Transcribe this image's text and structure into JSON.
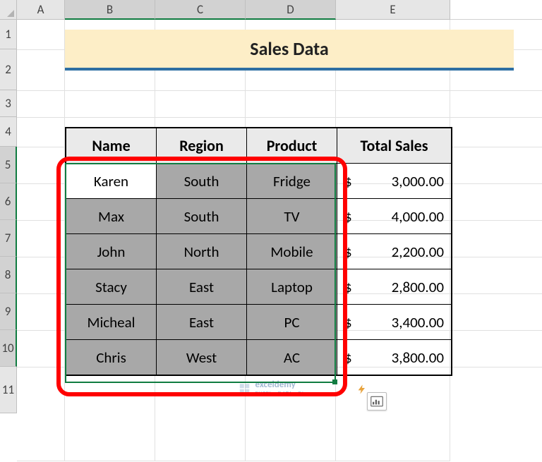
{
  "columns": [
    {
      "id": "A",
      "label": "A",
      "w": 68,
      "sel": false
    },
    {
      "id": "B",
      "label": "B",
      "w": 128,
      "sel": true
    },
    {
      "id": "C",
      "label": "C",
      "w": 128,
      "sel": true
    },
    {
      "id": "D",
      "label": "D",
      "w": 128,
      "sel": true
    },
    {
      "id": "E",
      "label": "E",
      "w": 162,
      "sel": false
    }
  ],
  "rows": [
    {
      "n": 1,
      "h": 42,
      "sel": false
    },
    {
      "n": 2,
      "h": 58,
      "sel": false
    },
    {
      "n": 3,
      "h": 38,
      "sel": false
    },
    {
      "n": 4,
      "h": 42,
      "sel": false
    },
    {
      "n": 5,
      "h": 52,
      "sel": true
    },
    {
      "n": 6,
      "h": 52,
      "sel": true
    },
    {
      "n": 7,
      "h": 52,
      "sel": true
    },
    {
      "n": 8,
      "h": 52,
      "sel": true
    },
    {
      "n": 9,
      "h": 52,
      "sel": true
    },
    {
      "n": 10,
      "h": 52,
      "sel": true
    },
    {
      "n": 11,
      "h": 66,
      "sel": false
    }
  ],
  "title": "Sales Data",
  "table": {
    "headers": [
      "Name",
      "Region",
      "Product",
      "Total Sales"
    ],
    "rows": [
      {
        "name": "Karen",
        "region": "South",
        "product": "Fridge",
        "total": "3,000.00"
      },
      {
        "name": "Max",
        "region": "South",
        "product": "TV",
        "total": "4,000.00"
      },
      {
        "name": "John",
        "region": "North",
        "product": "Mobile",
        "total": "2,200.00"
      },
      {
        "name": "Stacy",
        "region": "East",
        "product": "Laptop",
        "total": "2,800.00"
      },
      {
        "name": "Micheal",
        "region": "East",
        "product": "PC",
        "total": "3,400.00"
      },
      {
        "name": "Chris",
        "region": "West",
        "product": "AC",
        "total": "3,800.00"
      }
    ],
    "currency": "$"
  },
  "selection": {
    "from": "B5",
    "to": "D10",
    "active": "B5"
  },
  "watermark": {
    "brand": "exceldemy",
    "tagline": "EXCEL · DATA · BI"
  },
  "icons": {
    "quick_analysis": "quick-analysis-icon"
  }
}
